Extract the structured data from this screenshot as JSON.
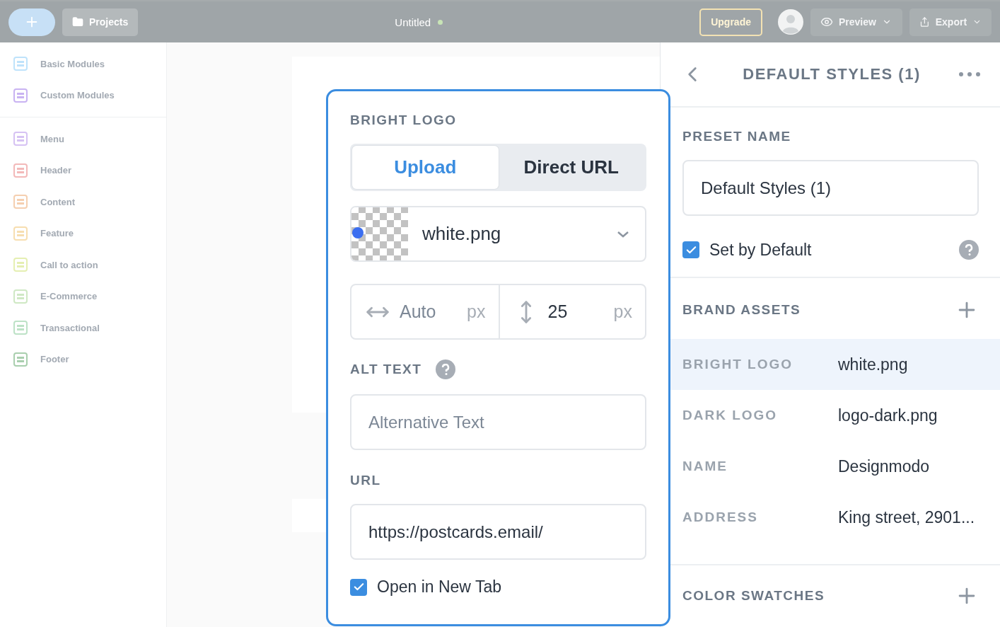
{
  "topbar": {
    "projects": "Projects",
    "document_title": "Untitled",
    "upgrade": "Upgrade",
    "preview": "Preview",
    "export": "Export"
  },
  "sidebar": {
    "groups": [
      [
        {
          "label": "Basic Modules",
          "color": "#bfe3fb"
        },
        {
          "label": "Custom Modules",
          "color": "#c9b3f2"
        }
      ],
      [
        {
          "label": "Menu",
          "color": "#d6c2f3"
        },
        {
          "label": "Header",
          "color": "#f3b9b9"
        },
        {
          "label": "Content",
          "color": "#f5cfb0"
        },
        {
          "label": "Feature",
          "color": "#f7deb0"
        },
        {
          "label": "Call to action",
          "color": "#e5efb2"
        },
        {
          "label": "E-Commerce",
          "color": "#cfe8c4"
        },
        {
          "label": "Transactional",
          "color": "#bde2c6"
        },
        {
          "label": "Footer",
          "color": "#a9cfae"
        }
      ]
    ]
  },
  "logo_popup": {
    "title": "BRIGHT LOGO",
    "tabs": [
      {
        "label": "Upload",
        "selected": true
      },
      {
        "label": "Direct URL",
        "selected": false
      }
    ],
    "file": {
      "name": "white.png"
    },
    "width": {
      "placeholder": "Auto",
      "unit": "px"
    },
    "height": {
      "value": "25",
      "unit": "px"
    },
    "alt_text": {
      "label": "ALT TEXT",
      "placeholder": "Alternative Text"
    },
    "url": {
      "label": "URL",
      "value": "https://postcards.email/"
    },
    "open_new_tab": {
      "label": "Open in New Tab",
      "checked": true
    }
  },
  "styles_panel": {
    "title": "DEFAULT STYLES (1)",
    "preset_name": {
      "label": "PRESET NAME",
      "value": "Default Styles (1)"
    },
    "set_default": {
      "label": "Set by Default",
      "checked": true
    },
    "brand_assets": {
      "title": "BRAND ASSETS",
      "rows": [
        {
          "label": "BRIGHT LOGO",
          "value": "white.png",
          "selected": true
        },
        {
          "label": "DARK LOGO",
          "value": "logo-dark.png",
          "selected": false
        },
        {
          "label": "NAME",
          "value": "Designmodo",
          "selected": false
        },
        {
          "label": "ADDRESS",
          "value": "King street, 2901...",
          "selected": false
        }
      ]
    },
    "color_swatches": {
      "title": "COLOR SWATCHES"
    }
  }
}
